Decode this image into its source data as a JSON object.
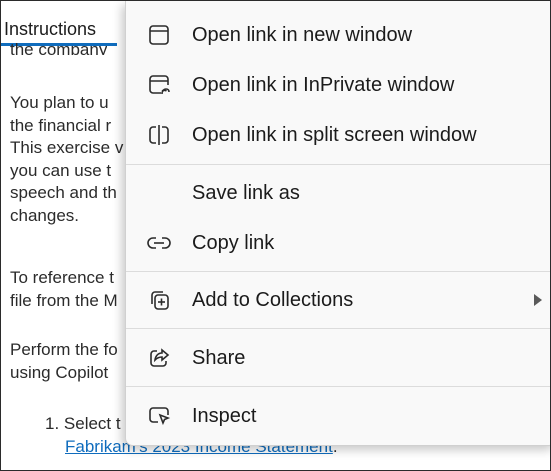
{
  "page": {
    "tab_label": "Instructions",
    "cut_off_line": "the company",
    "para1": [
      "You plan to u",
      "the financial r",
      "This exercise v",
      "you can use t",
      "speech and th",
      "changes."
    ],
    "para2": [
      "To reference t",
      "file from the M"
    ],
    "para3": [
      "Perform the fo",
      "using Copilot"
    ],
    "step1_prefix": "1. Select t",
    "step1_link": "Fabrikam's 2023 Income Statement",
    "step1_suffix": "."
  },
  "context_menu": {
    "items": [
      {
        "id": "open-new-window",
        "label": "Open link in new window",
        "icon": "window-icon"
      },
      {
        "id": "open-inprivate",
        "label": "Open link in InPrivate window",
        "icon": "inprivate-window-icon"
      },
      {
        "id": "open-split-screen",
        "label": "Open link in split screen window",
        "icon": "split-screen-icon"
      },
      {
        "id": "save-link-as",
        "label": "Save link as",
        "icon": ""
      },
      {
        "id": "copy-link",
        "label": "Copy link",
        "icon": "link-icon"
      },
      {
        "id": "add-to-collections",
        "label": "Add to Collections",
        "icon": "collections-add-icon",
        "submenu": true
      },
      {
        "id": "share",
        "label": "Share",
        "icon": "share-icon"
      },
      {
        "id": "inspect",
        "label": "Inspect",
        "icon": "inspect-icon"
      }
    ]
  },
  "colors": {
    "accent": "#0f6cbd",
    "menu_bg": "#f9f9f9",
    "text": "#1b1b1b"
  }
}
